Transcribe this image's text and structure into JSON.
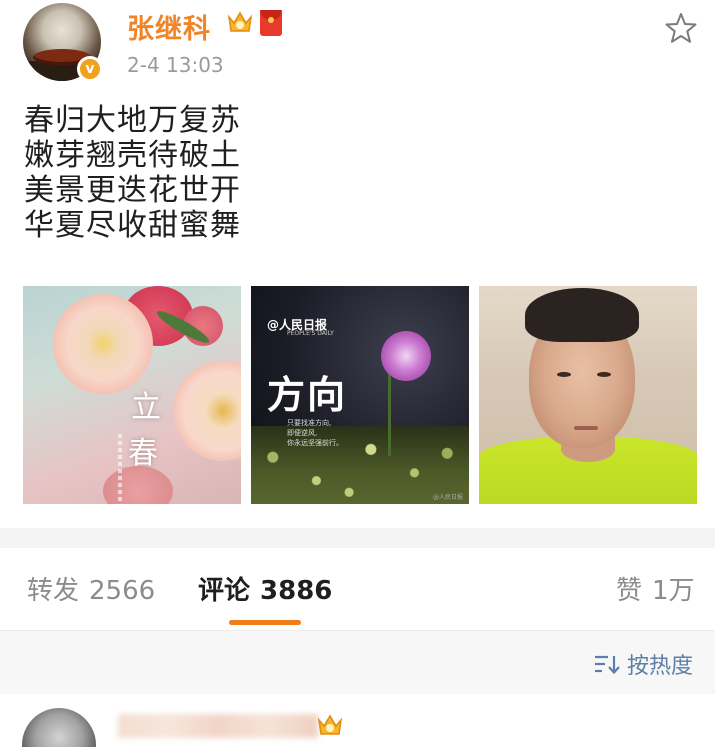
{
  "post": {
    "username": "张继科",
    "timestamp": "2-4 13:03",
    "verified_mark": "v",
    "poem": [
      "春归大地万复苏",
      "嫩芽翘壳待破土",
      "美景更迭花世开",
      "华夏尽收甜蜜舞"
    ],
    "images": [
      {
        "icon": "spring-blossom-image",
        "words": [
          "立",
          "春"
        ]
      },
      {
        "icon": "direction-poster-image",
        "logo": "@人民日报",
        "logo_sub": "PEOPLE'S DAILY",
        "title": "方向",
        "lines": [
          "只要找准方向,",
          "即便逆风,",
          "你永远坚强前行。"
        ],
        "watermark": "@人民日报"
      },
      {
        "icon": "selfie-photo-image"
      }
    ]
  },
  "tabs": {
    "repost_label": "转发",
    "repost_count": "2566",
    "comment_label": "评论",
    "comment_count": "3886",
    "like_label": "赞",
    "like_count": "1万"
  },
  "sort": {
    "label": "按热度"
  },
  "colors": {
    "accent": "#f07e1b",
    "username": "#f08426",
    "link": "#5d7ea8"
  }
}
